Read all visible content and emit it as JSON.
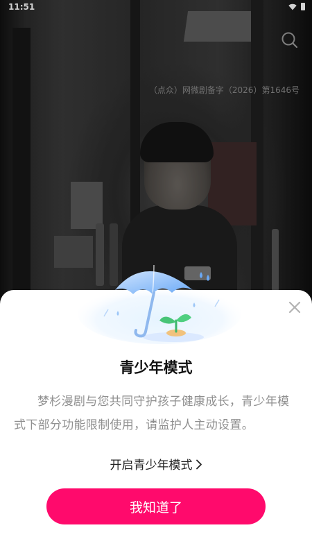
{
  "status_bar": {
    "time": "11:51",
    "icons": [
      "wifi-icon",
      "battery-icon"
    ]
  },
  "video": {
    "watermark": "（点众）网微剧备字（2026）第1646号"
  },
  "header": {
    "search_icon": "search-icon"
  },
  "dialog": {
    "illustration": "umbrella-sprout-illustration",
    "title": "青少年模式",
    "body": "梦杉漫剧与您共同守护孩子健康成长，青少年模式下部分功能限制使用，请监护人主动设置。",
    "enable_link_label": "开启青少年模式",
    "confirm_button_label": "我知道了",
    "close_icon": "close-icon"
  },
  "colors": {
    "accent": "#ff0a6c",
    "sheet_background": "#ffffff",
    "body_text": "#8f8f8f"
  }
}
